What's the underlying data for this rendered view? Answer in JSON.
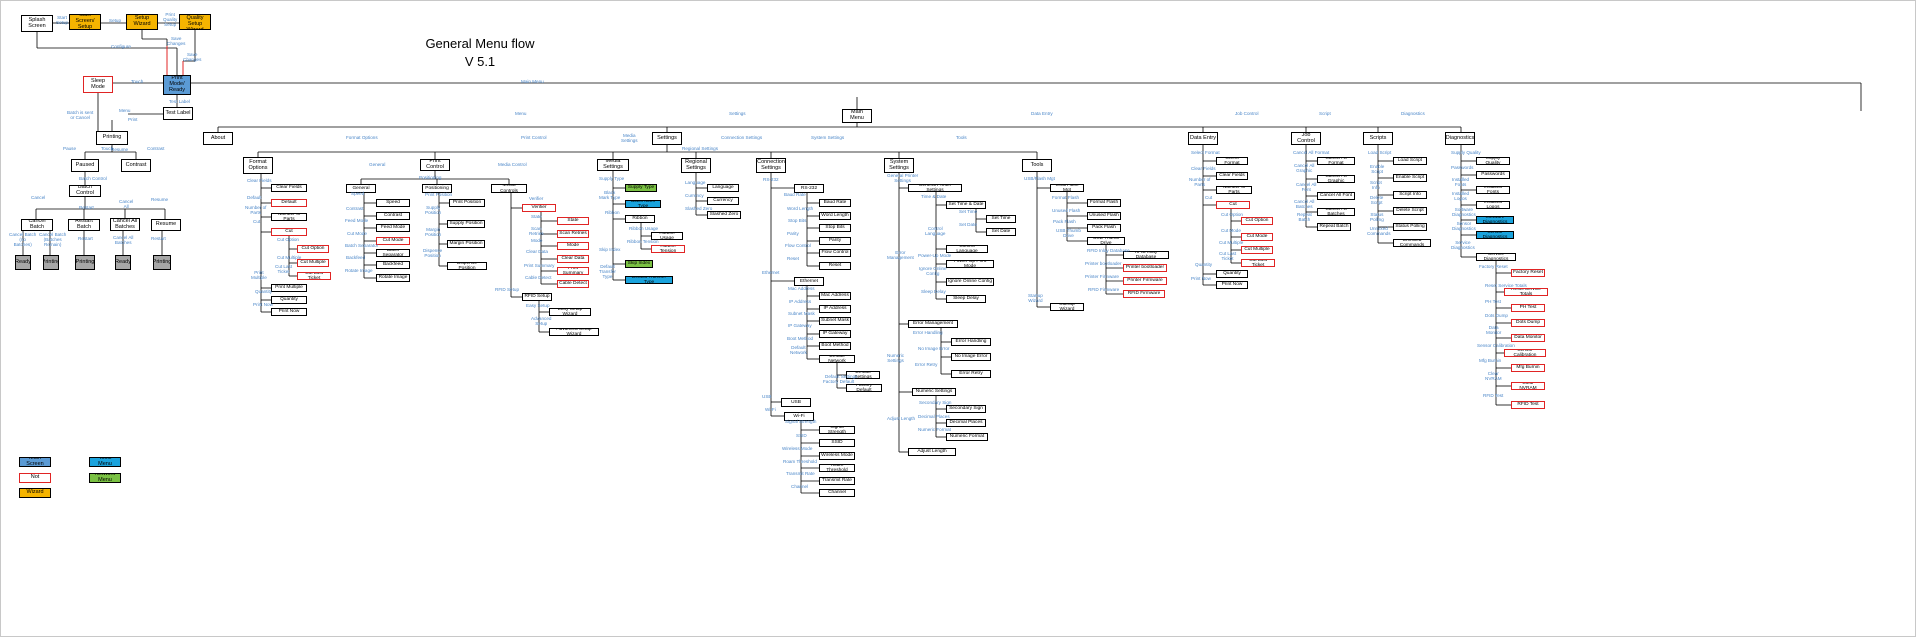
{
  "title": "General Menu flow\nV 5.1",
  "colors": {
    "wire": "#000000",
    "edge_label": "#4a86c8",
    "red": "#e02424",
    "orange": "#f5b400",
    "blue": "#5b9bd5",
    "cyan": "#1aa3dd",
    "green": "#7ac143",
    "gray": "#a6a6a6"
  },
  "nodes": [
    {
      "id": "splash",
      "label": "Splash Screen",
      "s": ""
    },
    {
      "id": "startscreen",
      "label": "Start Screen/\nSetup",
      "s": "orange"
    },
    {
      "id": "setupwiz",
      "label": "Setup Wizard",
      "s": "orange"
    },
    {
      "id": "pqwiz",
      "label": "Print Quality\nSetup Wizard",
      "s": "orange"
    },
    {
      "id": "sleep",
      "label": "Sleep Mode",
      "s": "red"
    },
    {
      "id": "ready",
      "label": "Print Mode/\nReady",
      "s": "blue"
    },
    {
      "id": "testlabel",
      "label": "Test Label",
      "s": ""
    },
    {
      "id": "printing",
      "label": "Printing",
      "s": ""
    },
    {
      "id": "paused",
      "label": "Paused",
      "s": ""
    },
    {
      "id": "contrast0",
      "label": "Contrast",
      "s": ""
    },
    {
      "id": "batchctl",
      "label": "Batch Control",
      "s": ""
    },
    {
      "id": "cancelbatch",
      "label": "Cancel Batch",
      "s": ""
    },
    {
      "id": "restartbatch",
      "label": "Restart Batch",
      "s": ""
    },
    {
      "id": "cancelallb",
      "label": "Cancel All\nBatches",
      "s": ""
    },
    {
      "id": "resume",
      "label": "Resume",
      "s": ""
    },
    {
      "id": "g1",
      "label": "Ready",
      "s": "gray"
    },
    {
      "id": "g2",
      "label": "Printing",
      "s": "gray"
    },
    {
      "id": "g3",
      "label": "Printing",
      "s": "gray"
    },
    {
      "id": "g4",
      "label": "Ready",
      "s": "gray"
    },
    {
      "id": "g5",
      "label": "Printing",
      "s": "gray"
    },
    {
      "id": "mainmenu",
      "label": "Main Menu",
      "s": ""
    },
    {
      "id": "about",
      "label": "About",
      "s": ""
    },
    {
      "id": "settings",
      "label": "Settings",
      "s": ""
    },
    {
      "id": "dataentry",
      "label": "Data Entry",
      "s": ""
    },
    {
      "id": "jobcontrol",
      "label": "Job Control",
      "s": ""
    },
    {
      "id": "scripts",
      "label": "Scripts",
      "s": ""
    },
    {
      "id": "diagnostics",
      "label": "Diagnostics",
      "s": ""
    },
    {
      "id": "formatopt",
      "label": "Format\nOptions",
      "s": ""
    },
    {
      "id": "fo_clear",
      "label": "Clear Fields",
      "s": ""
    },
    {
      "id": "fo_default",
      "label": "Default",
      "s": "red"
    },
    {
      "id": "fo_nparts",
      "label": "Number of Parts",
      "s": ""
    },
    {
      "id": "fo_cut",
      "label": "Cut",
      "s": "red"
    },
    {
      "id": "fo_cutopt",
      "label": "Cut Option",
      "s": "red"
    },
    {
      "id": "fo_cutmult",
      "label": "Cut Multiple",
      "s": "red"
    },
    {
      "id": "fo_cutlast",
      "label": "Cut Last Ticket",
      "s": "red"
    },
    {
      "id": "fo_printmult",
      "label": "Print Multiple",
      "s": ""
    },
    {
      "id": "fo_qty",
      "label": "Quantity",
      "s": ""
    },
    {
      "id": "fo_printnow",
      "label": "Print Now",
      "s": ""
    },
    {
      "id": "general",
      "label": "General",
      "s": ""
    },
    {
      "id": "printcontrol",
      "label": "Print Control",
      "s": ""
    },
    {
      "id": "mediacontrols",
      "label": "Media Controls",
      "s": ""
    },
    {
      "id": "ge_speed",
      "label": "Speed",
      "s": ""
    },
    {
      "id": "ge_contrast",
      "label": "Contrast",
      "s": ""
    },
    {
      "id": "ge_feed",
      "label": "Feed Mode",
      "s": ""
    },
    {
      "id": "ge_cutmode",
      "label": "Cut Mode",
      "s": "red"
    },
    {
      "id": "ge_batchsep",
      "label": "Batch Separator",
      "s": ""
    },
    {
      "id": "ge_backfeed",
      "label": "Backfeed",
      "s": ""
    },
    {
      "id": "ge_rotate",
      "label": "Rotate Image",
      "s": ""
    },
    {
      "id": "positioning",
      "label": "Positioning",
      "s": ""
    },
    {
      "id": "pc_printpos",
      "label": "Print Position",
      "s": ""
    },
    {
      "id": "pc_supplypos",
      "label": "Supply Position",
      "s": ""
    },
    {
      "id": "pc_marginpos",
      "label": "Margin Position",
      "s": ""
    },
    {
      "id": "pc_dispense",
      "label": "Dispense Position",
      "s": ""
    },
    {
      "id": "verifier",
      "label": "Verifier",
      "s": "red"
    },
    {
      "id": "vf_state",
      "label": "State",
      "s": "red"
    },
    {
      "id": "vf_scan",
      "label": "Scan Retries",
      "s": "red"
    },
    {
      "id": "vf_mode",
      "label": "Mode",
      "s": "red"
    },
    {
      "id": "vf_clear",
      "label": "Clear Data",
      "s": "red"
    },
    {
      "id": "vf_summary",
      "label": "Print Summary",
      "s": "red"
    },
    {
      "id": "vf_cable",
      "label": "Cable Detect",
      "s": "red"
    },
    {
      "id": "rfidsetup",
      "label": "RFID Setup",
      "s": ""
    },
    {
      "id": "rf_easy",
      "label": "Easy Setup Wizard",
      "s": ""
    },
    {
      "id": "rf_adv",
      "label": "Advanced Setup Wizard",
      "s": ""
    },
    {
      "id": "mediasettings",
      "label": "Media Settings",
      "s": ""
    },
    {
      "id": "ms_supply",
      "label": "Supply Type",
      "s": "green"
    },
    {
      "id": "ms_blackmark",
      "label": "Black Mark Type",
      "s": "cyan"
    },
    {
      "id": "ms_ribbon",
      "label": "Ribbon",
      "s": ""
    },
    {
      "id": "ms_ribbonusage",
      "label": "Ribbon Usage",
      "s": ""
    },
    {
      "id": "ms_ribbontension",
      "label": "Ribbon Tension",
      "s": "red"
    },
    {
      "id": "ms_skipindex",
      "label": "Skip Index",
      "s": "green"
    },
    {
      "id": "ms_transfer",
      "label": "Default Transfer Type",
      "s": "cyan"
    },
    {
      "id": "regional",
      "label": "Regional\nSettings",
      "s": ""
    },
    {
      "id": "rg_lang",
      "label": "Language",
      "s": ""
    },
    {
      "id": "rg_currency",
      "label": "Currency",
      "s": ""
    },
    {
      "id": "rg_slashed",
      "label": "Slashed Zero",
      "s": ""
    },
    {
      "id": "connection",
      "label": "Connection\nSettings",
      "s": ""
    },
    {
      "id": "rs232",
      "label": "RS-232",
      "s": ""
    },
    {
      "id": "rs_baud",
      "label": "Baud Rate",
      "s": ""
    },
    {
      "id": "rs_word",
      "label": "Word Length",
      "s": ""
    },
    {
      "id": "rs_stop",
      "label": "Stop Bits",
      "s": ""
    },
    {
      "id": "rs_parity",
      "label": "Parity",
      "s": ""
    },
    {
      "id": "rs_flow",
      "label": "Flow Control",
      "s": ""
    },
    {
      "id": "rs_reset",
      "label": "Reset",
      "s": ""
    },
    {
      "id": "ethernet",
      "label": "Ethernet",
      "s": ""
    },
    {
      "id": "et_mac",
      "label": "Mac Address",
      "s": ""
    },
    {
      "id": "et_ip",
      "label": "IP Address",
      "s": ""
    },
    {
      "id": "et_subnet",
      "label": "Subnet Mask",
      "s": ""
    },
    {
      "id": "et_gateway",
      "label": "IP Gateway",
      "s": ""
    },
    {
      "id": "et_boot",
      "label": "Boot Method",
      "s": ""
    },
    {
      "id": "et_defnet",
      "label": "Default Network",
      "s": ""
    },
    {
      "id": "et_defset",
      "label": "Default Settings",
      "s": ""
    },
    {
      "id": "et_factory",
      "label": "Factory Default",
      "s": ""
    },
    {
      "id": "usb",
      "label": "USB",
      "s": ""
    },
    {
      "id": "wifi",
      "label": "Wi-Fi",
      "s": ""
    },
    {
      "id": "wf_signal",
      "label": "Signal Strength",
      "s": ""
    },
    {
      "id": "wf_ssid",
      "label": "SSID",
      "s": ""
    },
    {
      "id": "wf_mode",
      "label": "Wireless Mode",
      "s": ""
    },
    {
      "id": "wf_roam",
      "label": "Roam Threshold",
      "s": ""
    },
    {
      "id": "wf_rate",
      "label": "Transmit Rate",
      "s": ""
    },
    {
      "id": "wf_channel",
      "label": "Channel",
      "s": ""
    },
    {
      "id": "system",
      "label": "System\nSettings",
      "s": ""
    },
    {
      "id": "genprinter",
      "label": "General Printer Settings",
      "s": ""
    },
    {
      "id": "sy_timedate",
      "label": "Set Time & Date",
      "s": ""
    },
    {
      "id": "sy_settime",
      "label": "Set Time",
      "s": ""
    },
    {
      "id": "sy_setdate",
      "label": "Set Date",
      "s": ""
    },
    {
      "id": "sy_ctrllang",
      "label": "Control Language",
      "s": ""
    },
    {
      "id": "sy_powerup",
      "label": "Power-Up Print Mode",
      "s": ""
    },
    {
      "id": "sy_ignore",
      "label": "Ignore Online Config",
      "s": ""
    },
    {
      "id": "sy_sleep",
      "label": "Sleep Delay",
      "s": ""
    },
    {
      "id": "errmgmt",
      "label": "Error Management",
      "s": ""
    },
    {
      "id": "em_handling",
      "label": "Error Handling",
      "s": ""
    },
    {
      "id": "em_noimage",
      "label": "No Image Error",
      "s": ""
    },
    {
      "id": "em_retry",
      "label": "Error Retry",
      "s": ""
    },
    {
      "id": "numeric",
      "label": "Numeric Settings",
      "s": ""
    },
    {
      "id": "nu_secsign",
      "label": "Secondary Sign",
      "s": ""
    },
    {
      "id": "nu_decimal",
      "label": "Decimal Places",
      "s": ""
    },
    {
      "id": "nu_format",
      "label": "Numeric Format",
      "s": ""
    },
    {
      "id": "adjlength",
      "label": "Adjust Length",
      "s": ""
    },
    {
      "id": "tools",
      "label": "Tools",
      "s": ""
    },
    {
      "id": "usbflash",
      "label": "USB/Flash Mgt",
      "s": ""
    },
    {
      "id": "tl_format",
      "label": "Format Flash",
      "s": ""
    },
    {
      "id": "tl_unused",
      "label": "Unused Flash",
      "s": ""
    },
    {
      "id": "tl_pack",
      "label": "Pack Flash",
      "s": ""
    },
    {
      "id": "tl_thumb",
      "label": "USB Thumb Drive",
      "s": ""
    },
    {
      "id": "tl_rfiddb",
      "label": "RFID Inlay Database",
      "s": ""
    },
    {
      "id": "tl_bootloader",
      "label": "Printer bootloader",
      "s": "red"
    },
    {
      "id": "tl_firmware",
      "label": "Printer Firmware",
      "s": "red"
    },
    {
      "id": "tl_rfidfw",
      "label": "RFID Firmware",
      "s": "red"
    },
    {
      "id": "tl_startup",
      "label": "Startup Wizard",
      "s": ""
    },
    {
      "id": "de_select",
      "label": "Select Format",
      "s": ""
    },
    {
      "id": "de_clear",
      "label": "Clear Fields",
      "s": ""
    },
    {
      "id": "de_nparts",
      "label": "Number of Parts",
      "s": ""
    },
    {
      "id": "de_cut",
      "label": "Cut",
      "s": "red"
    },
    {
      "id": "de_cutopt",
      "label": "Cut Option",
      "s": "red"
    },
    {
      "id": "de_cutmode",
      "label": "Cut Mode",
      "s": "red"
    },
    {
      "id": "de_cutmult",
      "label": "Cut Multiple",
      "s": "red"
    },
    {
      "id": "de_cutlast",
      "label": "Cut Last Ticket",
      "s": "red"
    },
    {
      "id": "de_qty",
      "label": "Quantity",
      "s": ""
    },
    {
      "id": "de_printnow",
      "label": "Print Now",
      "s": ""
    },
    {
      "id": "jc_cancelformat",
      "label": "Cancel All Format",
      "s": ""
    },
    {
      "id": "jc_cancelgraphic",
      "label": "Cancel All Graphic",
      "s": ""
    },
    {
      "id": "jc_cancelfont",
      "label": "Cancel All Font",
      "s": ""
    },
    {
      "id": "jc_cancelbatches",
      "label": "Cancel All Batches",
      "s": ""
    },
    {
      "id": "jc_repeat",
      "label": "Repeat Batch",
      "s": ""
    },
    {
      "id": "sc_load",
      "label": "Load Script",
      "s": ""
    },
    {
      "id": "sc_enable",
      "label": "Enable Script",
      "s": ""
    },
    {
      "id": "sc_info",
      "label": "Script Info",
      "s": ""
    },
    {
      "id": "sc_delete",
      "label": "Delete Script",
      "s": ""
    },
    {
      "id": "sc_status",
      "label": "Status Polling",
      "s": ""
    },
    {
      "id": "sc_unmixed",
      "label": "Unmixed Commands",
      "s": ""
    },
    {
      "id": "dg_supply",
      "label": "Supply Quality",
      "s": ""
    },
    {
      "id": "dg_passwords",
      "label": "Passwords",
      "s": ""
    },
    {
      "id": "dg_fonts",
      "label": "Installed Fonts",
      "s": ""
    },
    {
      "id": "dg_logos",
      "label": "Installed Logos",
      "s": ""
    },
    {
      "id": "dg_software",
      "label": "Software Diagnostics",
      "s": "cyan"
    },
    {
      "id": "dg_sensor",
      "label": "Sensor Diagnostics",
      "s": "cyan"
    },
    {
      "id": "dg_service",
      "label": "Service Diagnostics",
      "s": ""
    },
    {
      "id": "dg_factoryreset",
      "label": "Factory Reset",
      "s": "red"
    },
    {
      "id": "dg_resetservice",
      "label": "Reset Service Totals",
      "s": "red"
    },
    {
      "id": "dg_phtest",
      "label": "PH Test",
      "s": "red"
    },
    {
      "id": "dg_dotsdump",
      "label": "Dots Dump",
      "s": "red"
    },
    {
      "id": "dg_datamon",
      "label": "Data Monitor",
      "s": "red"
    },
    {
      "id": "dg_sensorcal",
      "label": "Sensor Calibration",
      "s": "red"
    },
    {
      "id": "dg_mfgburnin",
      "label": "Mfg Burnin",
      "s": "red"
    },
    {
      "id": "dg_clearnvram",
      "label": "Clear NVRAM",
      "s": "red"
    },
    {
      "id": "dg_rfidtest",
      "label": "RFID Test",
      "s": "red"
    },
    {
      "id": "lg_blue",
      "label": "Main Screen",
      "s": "blue"
    },
    {
      "id": "lg_red",
      "label": "Not",
      "s": "red"
    },
    {
      "id": "lg_orange",
      "label": "Wizard",
      "s": "orange"
    },
    {
      "id": "lg_cyan",
      "label": "Tools Menu",
      "s": "cyan"
    },
    {
      "id": "lg_green",
      "label": "Network Menu",
      "s": "green"
    }
  ],
  "edge_labels": [
    "Start\nSetup",
    "Setup",
    "Print\nQuality\nSetup",
    "Configure",
    "Save\nChanges",
    "Save\nChanges",
    "Touch",
    "Batch is sent\nor Cancel",
    "Test Label",
    "Menu",
    "Print",
    "Touch",
    "Pause",
    "Resume",
    "Contrast",
    "Batch Control",
    "Cancel",
    "Restart",
    "Cancel\nAll",
    "Resume",
    "Cancel Batch\n(no\nBatches)",
    "Cancel Batch\n(Batches\nRemain)",
    "Restart",
    "Cancel All\nBatches",
    "Restart",
    "Main Menu",
    "Menu",
    "Settings",
    "Data Entry",
    "Job Control",
    "Script",
    "Diagnostics",
    "Format Options",
    "Print Control",
    "Media\nSettings",
    "Connection Settings",
    "System Settings",
    "Tools",
    "Clear Fields",
    "Default",
    "Number of\nParts",
    "Cut",
    "Cut Option",
    "Cut Multiple",
    "Cut Last\nTicket",
    "Print\nMultiple",
    "Quantity",
    "Print Now",
    "General",
    "Media Control",
    "Speed",
    "Contrast",
    "Feed Mode",
    "Cut Mode",
    "Batch Separator",
    "Backfeed",
    "Rotate Image",
    "Positioning",
    "Print Position",
    "Supply\nPosition",
    "Margin\nPosition",
    "Dispense\nPosition",
    "Verifier",
    "State",
    "Scan\nRetries",
    "Mode",
    "Clear Data",
    "Print Summary",
    "Cable Detect",
    "RFID Setup",
    "Easy Setup",
    "Advanced\nSetup",
    "Supply Type",
    "Black\nMark Type",
    "Ribbon",
    "Ribbon Usage",
    "Ribbon Tension",
    "Skip Index",
    "Default\nTransfer\nType",
    "Regional Settings",
    "Language",
    "Currency",
    "Slashed Zero",
    "RS-232",
    "Baud Rate",
    "Word Length",
    "Stop Bits",
    "Parity",
    "Flow Control",
    "Reset",
    "Ethernet",
    "Mac Address",
    "IP Address",
    "Subnet Mask",
    "IP Gateway",
    "Boot Method",
    "Default\nNetwork",
    "Default Settings",
    "Factory Default",
    "USB",
    "Wi-Fi",
    "Signal Strength",
    "SSID",
    "Wireless Mode",
    "Roam Threshold",
    "Transmit Rate",
    "Channel",
    "General Printer\nSettings",
    "Time & Date",
    "Set Time",
    "Set Date",
    "Control\nLanguage",
    "Power-Up Mode",
    "Ignore Online\nConfig",
    "Sleep Delay",
    "Error\nManagement",
    "Error Handling",
    "No Image Error",
    "Error Retry",
    "Numeric\nSettings",
    "Secondary Sign",
    "Decimal Places",
    "Numeric Format",
    "Adjust Length",
    "USB/Flash Mgt",
    "Format Flash",
    "Unused Flash",
    "Pack Flash",
    "USB Thumb\nDrive",
    "RFID Inlay Database",
    "Printer bootloader",
    "Printer Firmware",
    "RFID Firmware",
    "Startup\nWizard",
    "Select Format",
    "Clear Fields",
    "Number of\nParts",
    "Cut",
    "Cut Option",
    "Cut Mode",
    "Cut Multiple",
    "Cut Last\nTicket",
    "Quantity",
    "Print Now",
    "Cancel All Format",
    "Cancel All\nGraphic",
    "Cancel All\nFont",
    "Cancel All\nBatches",
    "Repeat\nBatch",
    "Load Script",
    "Enable\nScript",
    "Script\nInfo",
    "Delete\nScript",
    "Status\nPolling",
    "Unmixed\nCommands",
    "Supply Quality",
    "Passwords",
    "Installed\nFonts",
    "Installed\nLogos",
    "Software\nDiagnostics",
    "Sensor\nDiagnostics",
    "Service\nDiagnostics",
    "Factory Reset",
    "Reset Service Totals",
    "PH Test",
    "Dots Dump",
    "Data\nMonitor",
    "Sensor Calibration",
    "Mfg Burnin",
    "Clear\nNVRAM",
    "RFID Test"
  ]
}
